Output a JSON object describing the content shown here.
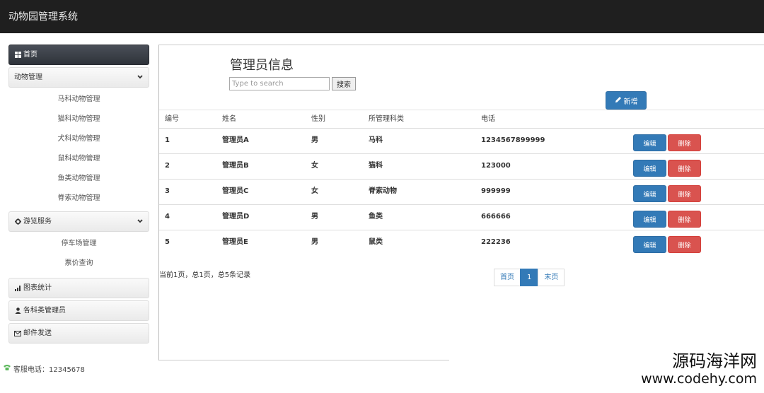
{
  "header": {
    "title": "动物园管理系统"
  },
  "sidebar": {
    "home": {
      "label": "首页",
      "icon": "grid-icon"
    },
    "animal_group": {
      "label": "动物管理",
      "items": [
        "马科动物管理",
        "猫科动物管理",
        "犬科动物管理",
        "鼠科动物管理",
        "鱼类动物管理",
        "脊索动物管理"
      ]
    },
    "tour_group": {
      "label": "游览服务",
      "icon": "gear-icon",
      "items": [
        "停车场管理",
        "票价查询"
      ]
    },
    "stats": {
      "label": "图表统计",
      "icon": "bar-chart-icon"
    },
    "admins": {
      "label": "各科类管理员",
      "icon": "user-icon"
    },
    "mail": {
      "label": "邮件发送",
      "icon": "envelope-icon"
    }
  },
  "footer": {
    "contact": "客服电话：12345678"
  },
  "main": {
    "title": "管理员信息",
    "search": {
      "placeholder": "Type to search",
      "button": "搜索"
    },
    "add_button": "新增",
    "table": {
      "columns": [
        "编号",
        "姓名",
        "性别",
        "所管理科类",
        "电话"
      ],
      "rows": [
        {
          "id": "1",
          "name": "管理员A",
          "gender": "男",
          "category": "马科",
          "phone": "1234567899999"
        },
        {
          "id": "2",
          "name": "管理员B",
          "gender": "女",
          "category": "猫科",
          "phone": "123000"
        },
        {
          "id": "3",
          "name": "管理员C",
          "gender": "女",
          "category": "脊索动物",
          "phone": "999999"
        },
        {
          "id": "4",
          "name": "管理员D",
          "gender": "男",
          "category": "鱼类",
          "phone": "666666"
        },
        {
          "id": "5",
          "name": "管理员E",
          "gender": "男",
          "category": "鼠类",
          "phone": "222236"
        }
      ],
      "edit_label": "编辑",
      "delete_label": "删除"
    },
    "pagination": {
      "info": "当前1页，总1页，总5条记录",
      "first": "首页",
      "current": "1",
      "last": "末页"
    }
  },
  "watermark": {
    "line1": "源码海洋网",
    "line2": "www.codehy.com"
  },
  "colors": {
    "primary": "#337ab7",
    "danger": "#d9534f",
    "topbar": "#1f1f1f"
  }
}
